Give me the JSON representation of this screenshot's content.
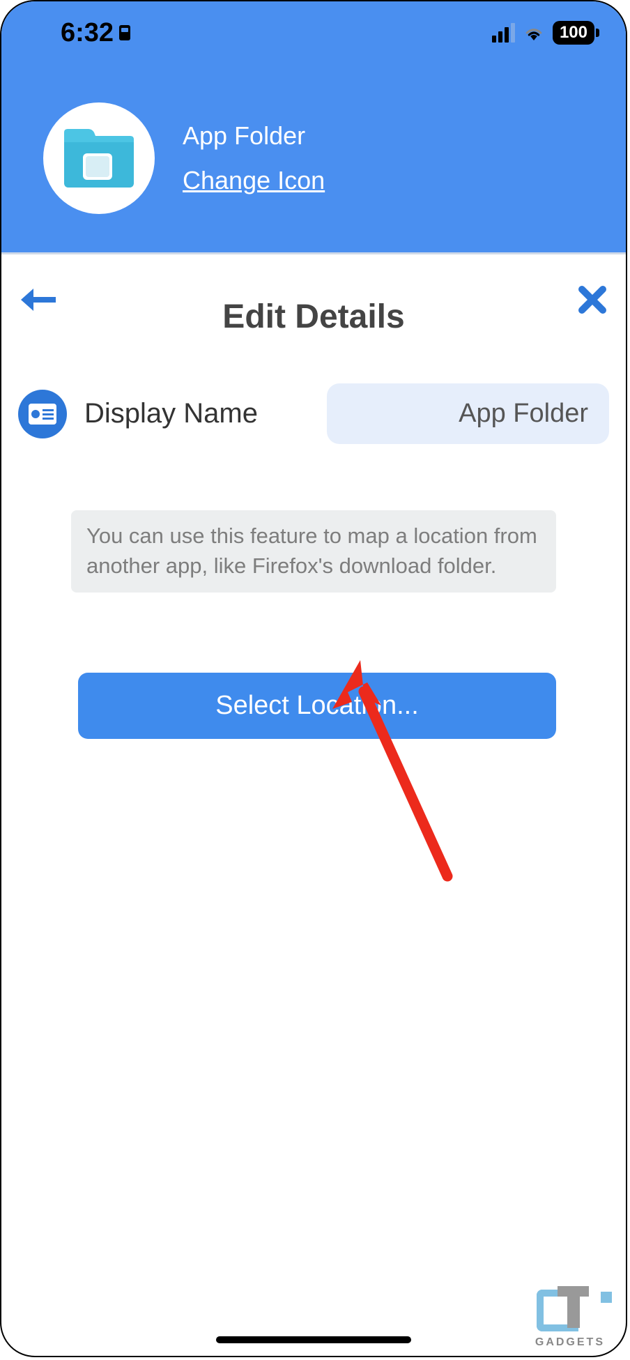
{
  "status": {
    "time": "6:32",
    "battery": "100"
  },
  "header": {
    "title": "App Folder",
    "change_icon_label": "Change Icon"
  },
  "nav": {
    "page_title": "Edit Details"
  },
  "form": {
    "display_name_label": "Display Name",
    "display_name_value": "App Folder",
    "info_text": "You can use this feature to map a location from another app, like Firefox's download folder.",
    "select_location_label": "Select Location..."
  },
  "watermark": {
    "text": "GADGETS"
  }
}
